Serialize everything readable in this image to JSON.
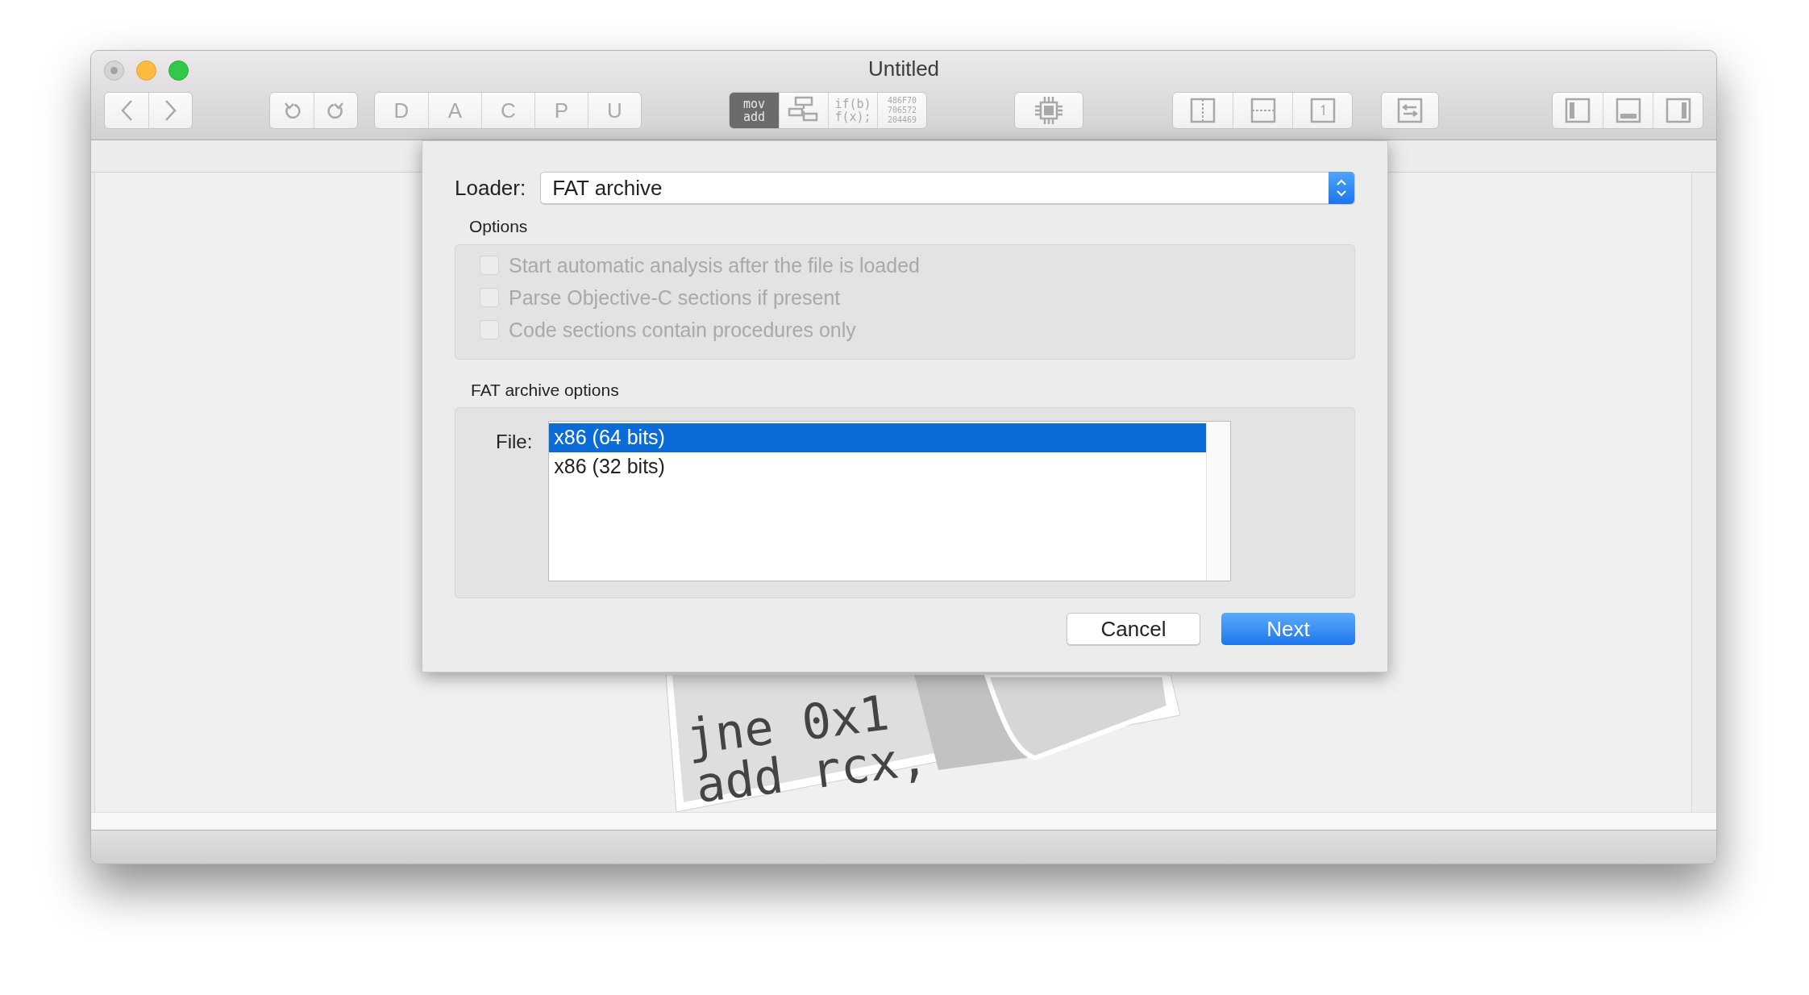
{
  "window": {
    "title": "Untitled"
  },
  "toolbar": [
    {
      "items": [
        {
          "kind": "back"
        },
        {
          "kind": "forward"
        }
      ]
    },
    {
      "items": [
        {
          "kind": "undo"
        },
        {
          "kind": "redo"
        }
      ]
    },
    {
      "items": [
        {
          "kind": "text",
          "label": "D"
        },
        {
          "kind": "text",
          "label": "A"
        },
        {
          "kind": "text",
          "label": "C"
        },
        {
          "kind": "text",
          "label": "P"
        },
        {
          "kind": "text",
          "label": "U"
        }
      ]
    },
    {
      "items": [
        {
          "kind": "code",
          "lines": [
            "mov",
            "add"
          ],
          "selected": true
        },
        {
          "kind": "graph",
          "selected": false
        },
        {
          "kind": "code",
          "lines": [
            "if(b)",
            "f(x);"
          ],
          "selected": false
        },
        {
          "kind": "hex",
          "lines": [
            "486F70",
            "706572",
            "204469"
          ],
          "selected": false
        }
      ]
    },
    {
      "items": [
        {
          "kind": "chip"
        }
      ]
    },
    {
      "items": [
        {
          "kind": "split-v"
        },
        {
          "kind": "split-h"
        },
        {
          "kind": "single"
        }
      ]
    },
    {
      "items": [
        {
          "kind": "swap"
        }
      ]
    },
    {
      "items": [
        {
          "kind": "left-pane"
        },
        {
          "kind": "bottom-pane"
        },
        {
          "kind": "right-pane"
        }
      ]
    }
  ],
  "dialog": {
    "loader_label": "Loader:",
    "loader_value": "FAT archive",
    "options_title": "Options",
    "options": [
      {
        "label": "Start automatic analysis after the file is loaded",
        "checked": false,
        "disabled": true
      },
      {
        "label": "Parse Objective-C sections if present",
        "checked": false,
        "disabled": true
      },
      {
        "label": "Code sections contain procedures only",
        "checked": false,
        "disabled": true
      }
    ],
    "archive_title": "FAT archive options",
    "file_label": "File:",
    "files": [
      {
        "label": "x86 (64 bits)",
        "selected": true
      },
      {
        "label": "x86 (32 bits)",
        "selected": false
      }
    ],
    "buttons": [
      {
        "label": "Cancel",
        "kind": "secondary"
      },
      {
        "label": "Next",
        "kind": "primary"
      }
    ]
  },
  "artwork": {
    "lines": [
      "jne 0x1",
      "add rcx,"
    ]
  }
}
